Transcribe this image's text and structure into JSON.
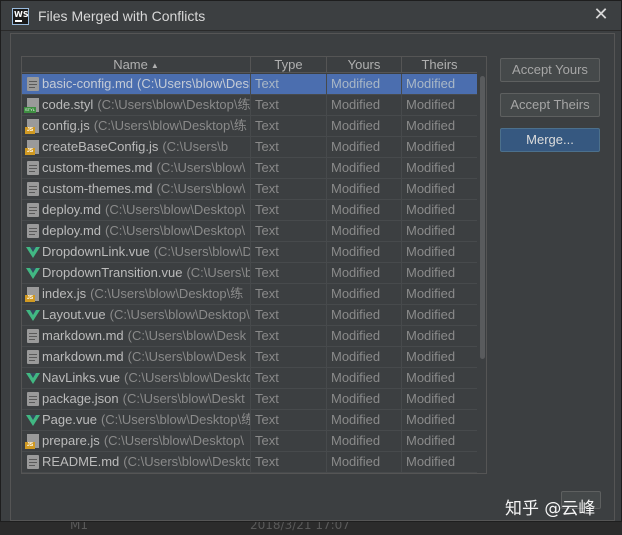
{
  "dialog": {
    "app_icon_label": "WS",
    "title": "Files Merged with Conflicts",
    "close_glyph": "✕"
  },
  "table": {
    "columns": {
      "name": "Name",
      "name_sort": "▲",
      "type": "Type",
      "yours": "Yours",
      "theirs": "Theirs"
    },
    "rows": [
      {
        "icon": "text-file-icon",
        "name": "basic-config.md",
        "path": "(C:\\Users\\blow\\Desk",
        "type": "Text",
        "yours": "Modified",
        "theirs": "Modified",
        "selected": true
      },
      {
        "icon": "styl-file-icon",
        "name": "code.styl",
        "path": "(C:\\Users\\blow\\Desktop\\练",
        "type": "Text",
        "yours": "Modified",
        "theirs": "Modified"
      },
      {
        "icon": "js-file-icon",
        "name": "config.js",
        "path": "(C:\\Users\\blow\\Desktop\\练",
        "type": "Text",
        "yours": "Modified",
        "theirs": "Modified"
      },
      {
        "icon": "js-file-icon",
        "name": "createBaseConfig.js",
        "path": "(C:\\Users\\b",
        "type": "Text",
        "yours": "Modified",
        "theirs": "Modified"
      },
      {
        "icon": "text-file-icon",
        "name": "custom-themes.md",
        "path": "(C:\\Users\\blow\\",
        "type": "Text",
        "yours": "Modified",
        "theirs": "Modified"
      },
      {
        "icon": "text-file-icon",
        "name": "custom-themes.md",
        "path": "(C:\\Users\\blow\\",
        "type": "Text",
        "yours": "Modified",
        "theirs": "Modified"
      },
      {
        "icon": "text-file-icon",
        "name": "deploy.md",
        "path": "(C:\\Users\\blow\\Desktop\\",
        "type": "Text",
        "yours": "Modified",
        "theirs": "Modified"
      },
      {
        "icon": "text-file-icon",
        "name": "deploy.md",
        "path": "(C:\\Users\\blow\\Desktop\\",
        "type": "Text",
        "yours": "Modified",
        "theirs": "Modified"
      },
      {
        "icon": "vue-file-icon",
        "name": "DropdownLink.vue",
        "path": "(C:\\Users\\blow\\D",
        "type": "Text",
        "yours": "Modified",
        "theirs": "Modified"
      },
      {
        "icon": "vue-file-icon",
        "name": "DropdownTransition.vue",
        "path": "(C:\\Users\\b",
        "type": "Text",
        "yours": "Modified",
        "theirs": "Modified"
      },
      {
        "icon": "js-file-icon",
        "name": "index.js",
        "path": "(C:\\Users\\blow\\Desktop\\练",
        "type": "Text",
        "yours": "Modified",
        "theirs": "Modified"
      },
      {
        "icon": "vue-file-icon",
        "name": "Layout.vue",
        "path": "(C:\\Users\\blow\\Desktop\\",
        "type": "Text",
        "yours": "Modified",
        "theirs": "Modified"
      },
      {
        "icon": "text-file-icon",
        "name": "markdown.md",
        "path": "(C:\\Users\\blow\\Desk",
        "type": "Text",
        "yours": "Modified",
        "theirs": "Modified"
      },
      {
        "icon": "text-file-icon",
        "name": "markdown.md",
        "path": "(C:\\Users\\blow\\Desk",
        "type": "Text",
        "yours": "Modified",
        "theirs": "Modified"
      },
      {
        "icon": "vue-file-icon",
        "name": "NavLinks.vue",
        "path": "(C:\\Users\\blow\\Deskto",
        "type": "Text",
        "yours": "Modified",
        "theirs": "Modified"
      },
      {
        "icon": "text-file-icon",
        "name": "package.json",
        "path": "(C:\\Users\\blow\\Deskt",
        "type": "Text",
        "yours": "Modified",
        "theirs": "Modified"
      },
      {
        "icon": "vue-file-icon",
        "name": "Page.vue",
        "path": "(C:\\Users\\blow\\Desktop\\练",
        "type": "Text",
        "yours": "Modified",
        "theirs": "Modified"
      },
      {
        "icon": "js-file-icon",
        "name": "prepare.js",
        "path": "(C:\\Users\\blow\\Desktop\\",
        "type": "Text",
        "yours": "Modified",
        "theirs": "Modified"
      },
      {
        "icon": "text-file-icon",
        "name": "README.md",
        "path": "(C:\\Users\\blow\\Deskto",
        "type": "Text",
        "yours": "Modified",
        "theirs": "Modified"
      }
    ]
  },
  "buttons": {
    "accept_yours": "Accept Yours",
    "accept_theirs": "Accept Theirs",
    "merge": "Merge..."
  },
  "background": {
    "bottom_left": "M1",
    "bottom_date": "2018/3/21 17:07"
  },
  "watermark": "知乎 @云峰"
}
